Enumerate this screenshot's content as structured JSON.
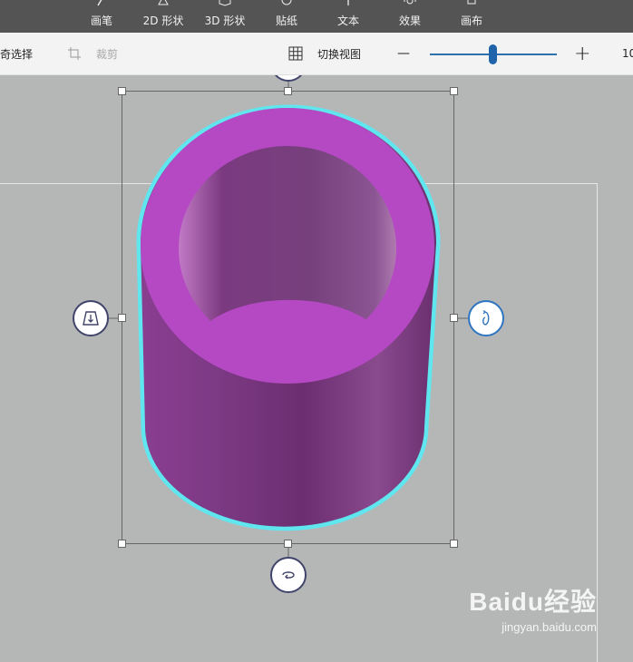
{
  "toolbar": {
    "items": [
      {
        "label": "画笔",
        "icon": "brush-icon"
      },
      {
        "label": "2D 形状",
        "icon": "2d-shapes-icon"
      },
      {
        "label": "3D 形状",
        "icon": "3d-shapes-icon"
      },
      {
        "label": "贴纸",
        "icon": "sticker-icon"
      },
      {
        "label": "文本",
        "icon": "text-icon"
      },
      {
        "label": "效果",
        "icon": "effects-icon"
      },
      {
        "label": "画布",
        "icon": "canvas-icon"
      }
    ]
  },
  "cmdbar": {
    "magic_select_label": "奇选择",
    "crop_label": "裁剪",
    "toggle_view_label": "切换视图",
    "zoom_value": "10",
    "zoom_minus": "—",
    "zoom_plus": "+",
    "zoom_level_fraction": 0.47
  },
  "colors": {
    "cylinder": "#b549c4",
    "cylinder_dark": "#6e2f72",
    "selection_glow": "#5fe6ee",
    "accent": "#1f64aa"
  },
  "watermark": {
    "main": "Baidu经验",
    "sub": "jingyan.baidu.com"
  }
}
